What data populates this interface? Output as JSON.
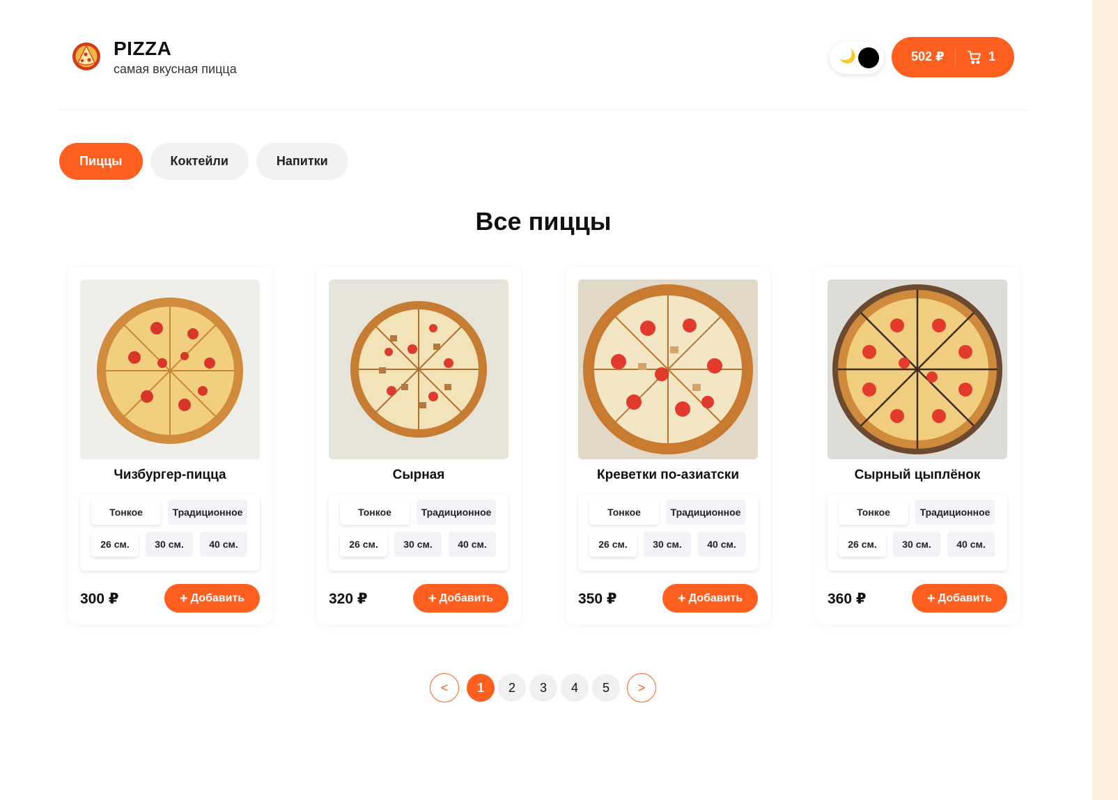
{
  "header": {
    "brand_title": "PIZZA",
    "brand_subtitle": "самая вкусная пицца",
    "logo_icon": "pizza-slice-icon",
    "theme_icon": "moon-icon",
    "theme_glyph": "🌙",
    "cart": {
      "total": "502 ₽",
      "count": "1",
      "icon": "cart-icon"
    }
  },
  "tabs": [
    {
      "label": "Пиццы",
      "active": true
    },
    {
      "label": "Коктейли",
      "active": false
    },
    {
      "label": "Напитки",
      "active": false
    }
  ],
  "section_title": "Все пиццы",
  "products": [
    {
      "name": "Чизбургер-пицца",
      "price": "300 ₽",
      "types": [
        "Тонкое",
        "Традиционное"
      ],
      "sizes": [
        "26 см.",
        "30 см.",
        "40 см."
      ],
      "add_label": "Добавить"
    },
    {
      "name": "Сырная",
      "price": "320 ₽",
      "types": [
        "Тонкое",
        "Традиционное"
      ],
      "sizes": [
        "26 см.",
        "30 см.",
        "40 см."
      ],
      "add_label": "Добавить"
    },
    {
      "name": "Креветки по-азиатски",
      "price": "350 ₽",
      "types": [
        "Тонкое",
        "Традиционное"
      ],
      "sizes": [
        "26 см.",
        "30 см.",
        "40 см."
      ],
      "add_label": "Добавить"
    },
    {
      "name": "Сырный цыплёнок",
      "price": "360 ₽",
      "types": [
        "Тонкое",
        "Традиционное"
      ],
      "sizes": [
        "26 см.",
        "30 см.",
        "40 см."
      ],
      "add_label": "Добавить"
    }
  ],
  "pagination": {
    "prev": "<",
    "pages": [
      "1",
      "2",
      "3",
      "4",
      "5"
    ],
    "next": ">",
    "current": "1"
  },
  "colors": {
    "accent": "#fe5f1e",
    "chip": "#f2f2f5"
  }
}
